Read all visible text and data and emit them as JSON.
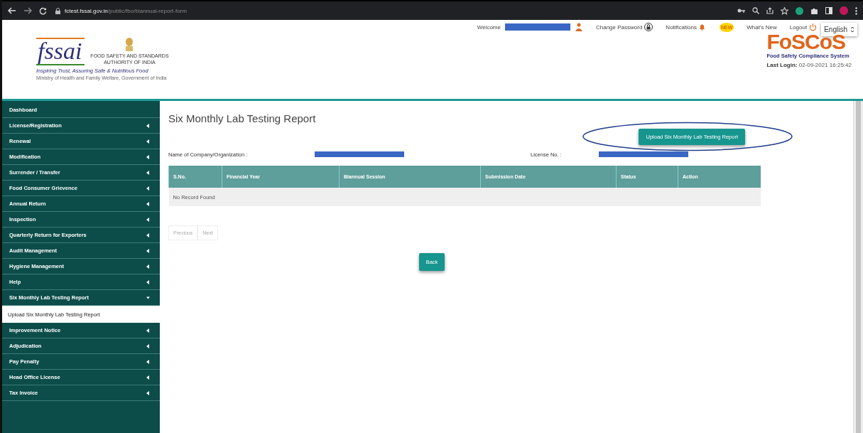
{
  "browser": {
    "url_host": "fctest.fssai.gov.in",
    "url_path": "/public/fbo/biannual-report-form"
  },
  "header": {
    "logo_text": "fssai",
    "org_name": [
      "FOOD SAFETY AND STANDARDS",
      "AUTHORITY OF INDIA"
    ],
    "tagline": "Inspiring Trust, Assuring Safe & Nutritious Food",
    "ministry": "Ministry of Health and Family Welfare, Government of India",
    "welcome": "Welcome",
    "change_password": "Change Password",
    "notifications": "Notifications",
    "new_badge": "NEW",
    "whats_new": "What's New",
    "logout": "Logout",
    "language": "English",
    "brand": "FoSCoS",
    "brand_sub": "Food Safety Compliance System",
    "last_login_label": "Last Login:",
    "last_login": "02-09-2021 16:25:42"
  },
  "sidebar": {
    "items": [
      {
        "label": "Dashboard",
        "has_caret": false
      },
      {
        "label": "License/Registration",
        "has_caret": true,
        "expanded": false
      },
      {
        "label": "Renewal",
        "has_caret": true,
        "expanded": false
      },
      {
        "label": "Modification",
        "has_caret": true,
        "expanded": false
      },
      {
        "label": "Surrender / Transfer",
        "has_caret": true,
        "expanded": false
      },
      {
        "label": "Food Consumer Grievence",
        "has_caret": true,
        "expanded": false
      },
      {
        "label": "Annual Return",
        "has_caret": true,
        "expanded": false
      },
      {
        "label": "Inspection",
        "has_caret": true,
        "expanded": false
      },
      {
        "label": "Quarterly Return for Exporters",
        "has_caret": true,
        "expanded": false
      },
      {
        "label": "Audit Management",
        "has_caret": true,
        "expanded": false
      },
      {
        "label": "Hygiene Management",
        "has_caret": true,
        "expanded": false
      },
      {
        "label": "Help",
        "has_caret": true,
        "expanded": false
      },
      {
        "label": "Six Monthly Lab Testing Report",
        "has_caret": true,
        "expanded": true,
        "children": [
          {
            "label": "Upload Six Monthly Lab Testing Report",
            "selected": true
          }
        ]
      },
      {
        "label": "Improvement Notice",
        "has_caret": true,
        "expanded": false
      },
      {
        "label": "Adjudication",
        "has_caret": true,
        "expanded": false
      },
      {
        "label": "Pay Penalty",
        "has_caret": true,
        "expanded": false
      },
      {
        "label": "Head Office License",
        "has_caret": true,
        "expanded": false
      },
      {
        "label": "Tax Invoice",
        "has_caret": true,
        "expanded": false
      }
    ]
  },
  "main": {
    "title": "Six Monthly Lab Testing Report",
    "upload_button": "Upload Six Monthly Lab Testing Report",
    "company_label": "Name of Company/Organization :",
    "license_label": "License No. :",
    "table": {
      "columns": [
        "S.No.",
        "Financial Year",
        "Biannual Session",
        "Submission Date",
        "Status",
        "Action"
      ],
      "empty_text": "No Record Found"
    },
    "pagination": [
      {
        "label": "Previous",
        "disabled": true
      },
      {
        "label": "Next",
        "disabled": true
      }
    ],
    "back_button": "Back"
  }
}
